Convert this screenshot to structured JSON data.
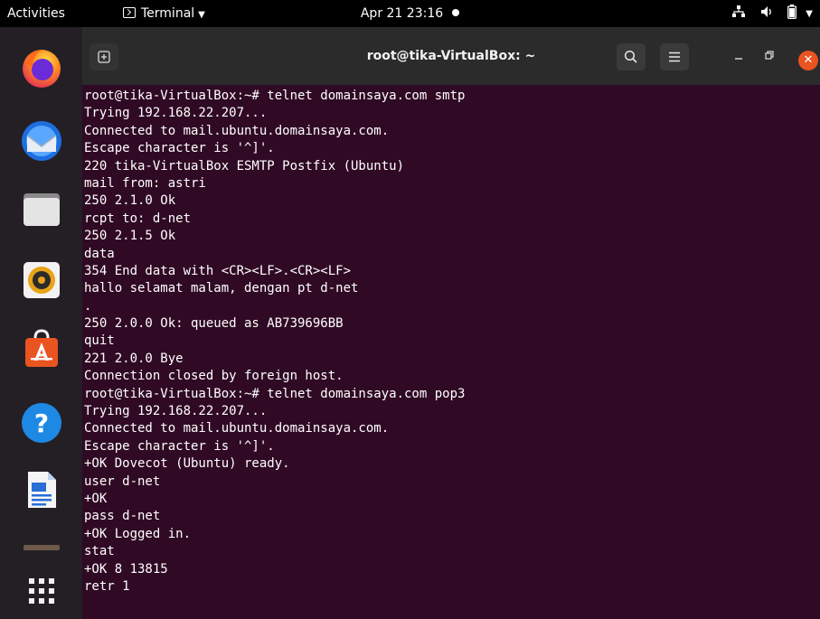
{
  "topbar": {
    "activities": "Activities",
    "app_menu": "Terminal",
    "clock": "Apr 21  23:16"
  },
  "dock": {
    "items": [
      "firefox-icon",
      "thunderbird-icon",
      "files-icon",
      "rhythmbox-icon",
      "software-icon",
      "help-icon",
      "writer-icon",
      "trash-icon",
      "show-apps-icon"
    ]
  },
  "window": {
    "title": "root@tika-VirtualBox: ~",
    "colors": {
      "background": "#300a24",
      "header": "#2b2b2b",
      "close": "#e95420"
    }
  },
  "terminal": {
    "lines": [
      "root@tika-VirtualBox:~# telnet domainsaya.com smtp",
      "Trying 192.168.22.207...",
      "Connected to mail.ubuntu.domainsaya.com.",
      "Escape character is '^]'.",
      "220 tika-VirtualBox ESMTP Postfix (Ubuntu)",
      "mail from: astri",
      "250 2.1.0 Ok",
      "rcpt to: d-net",
      "250 2.1.5 Ok",
      "data",
      "354 End data with <CR><LF>.<CR><LF>",
      "hallo selamat malam, dengan pt d-net",
      ".",
      "250 2.0.0 Ok: queued as AB739696BB",
      "quit",
      "221 2.0.0 Bye",
      "Connection closed by foreign host.",
      "root@tika-VirtualBox:~# telnet domainsaya.com pop3",
      "Trying 192.168.22.207...",
      "Connected to mail.ubuntu.domainsaya.com.",
      "Escape character is '^]'.",
      "+OK Dovecot (Ubuntu) ready.",
      "user d-net",
      "+OK",
      "pass d-net",
      "+OK Logged in.",
      "stat",
      "+OK 8 13815",
      "retr 1"
    ]
  }
}
